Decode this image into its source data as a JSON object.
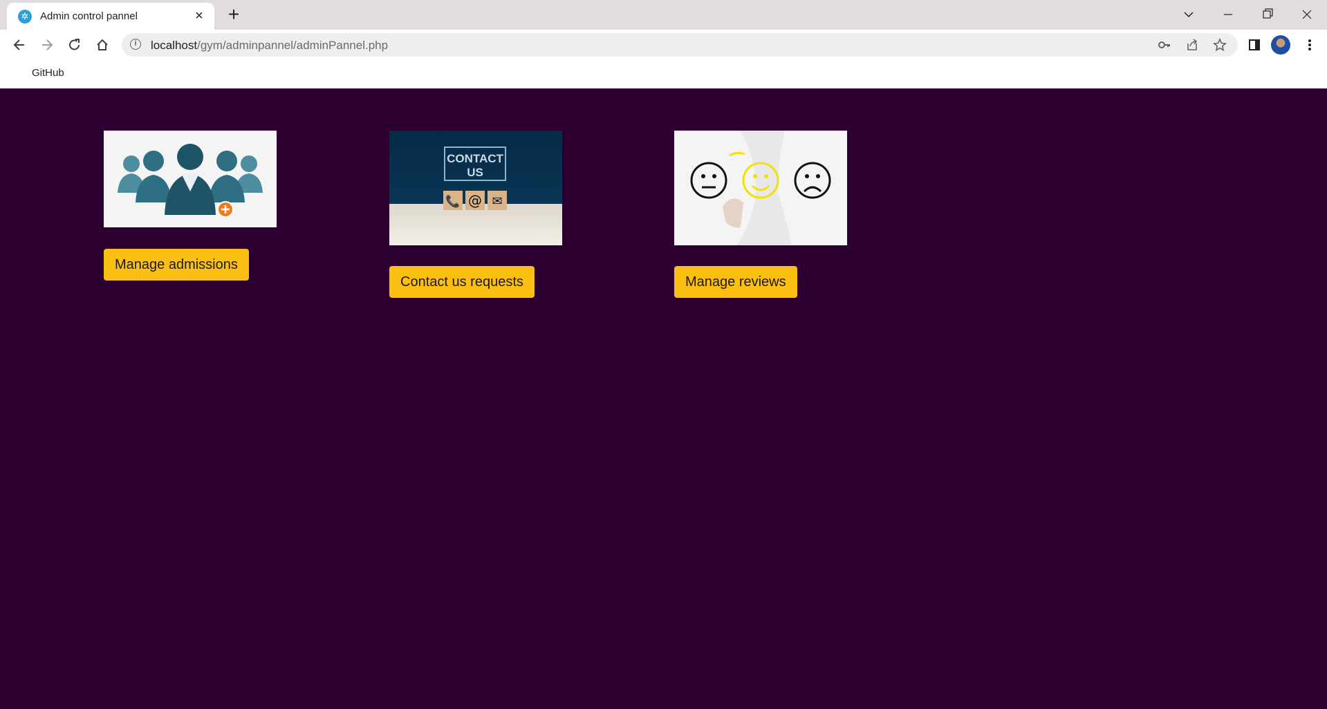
{
  "browser": {
    "tab_title": "Admin control pannel",
    "url_host": "localhost",
    "url_path": "/gym/adminpannel/adminPannel.php",
    "bookmarks": [
      "GitHub"
    ]
  },
  "cards": [
    {
      "button_label": "Manage admissions",
      "image": "people-group-add-icon"
    },
    {
      "button_label": "Contact us requests",
      "image": "contact-us-blocks-image"
    },
    {
      "button_label": "Manage reviews",
      "image": "emoji-rating-faces-image"
    }
  ],
  "colors": {
    "page_background": "#2b0030",
    "button_background": "#fbbe13",
    "chrome_tabstrip": "#e3dcdc"
  },
  "card_images": {
    "contact_text_line1": "CONTACT",
    "contact_text_line2": "US",
    "contact_blocks": [
      "📞",
      "@",
      "✉"
    ]
  }
}
